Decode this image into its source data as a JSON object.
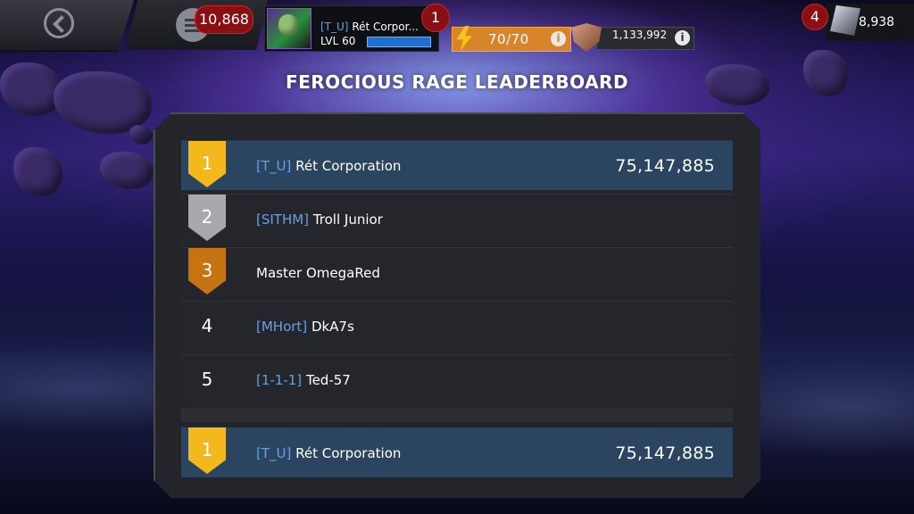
{
  "topbar": {
    "units": "10,868",
    "profile": {
      "alliance_tag": "[T_U]",
      "name": "Rét Corpor...",
      "level": "LVL 60",
      "notifications": "1"
    },
    "energy": "70/70",
    "energy_info": "i",
    "battlechips": "1,133,992",
    "battlechips_info": "i",
    "crystal_notifications": "4",
    "gold": "8,938"
  },
  "title": "FEROCIOUS RAGE LEADERBOARD",
  "leaderboard": [
    {
      "rank": "1",
      "tag": "[T_U]",
      "name": "Rét Corporation",
      "score": "75,147,885"
    },
    {
      "rank": "2",
      "tag": "[SITHM]",
      "name": "Troll Junior",
      "score": ""
    },
    {
      "rank": "3",
      "tag": "",
      "name": "Master OmegaRed",
      "score": ""
    },
    {
      "rank": "4",
      "tag": "[MHort]",
      "name": "DkA7s",
      "score": ""
    },
    {
      "rank": "5",
      "tag": "[1-1-1]",
      "name": "Ted-57",
      "score": ""
    }
  ],
  "my_entry": {
    "rank": "1",
    "tag": "[T_U]",
    "name": "Rét Corporation",
    "score": "75,147,885"
  },
  "colors": {
    "gold": "#f2b81c",
    "silver": "#a8a8ad",
    "bronze": "#c67312",
    "highlight_row": "#2b4560",
    "tag_blue": "#6aa0e0"
  }
}
